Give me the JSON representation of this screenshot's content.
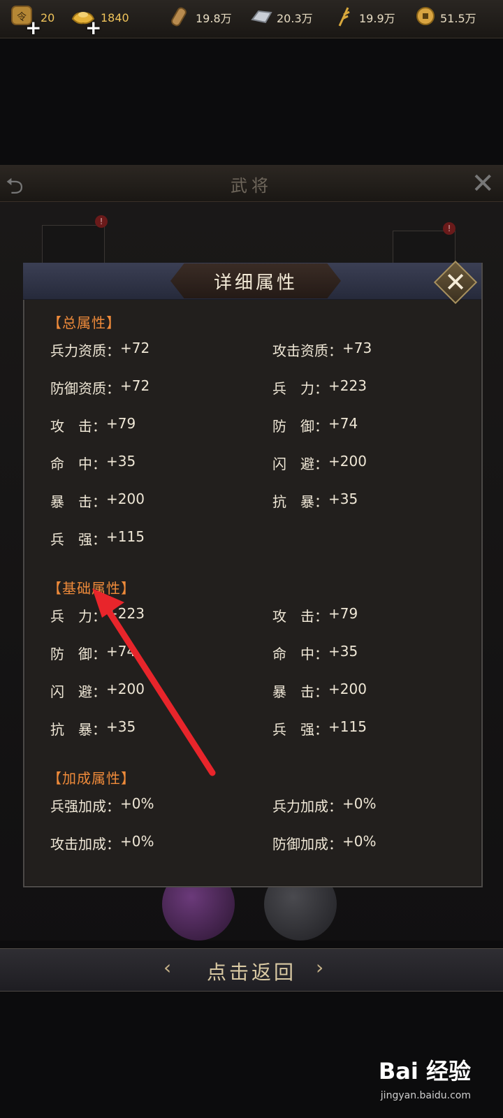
{
  "resources": {
    "tokens": "20",
    "gold": "1840",
    "wood": "19.8万",
    "iron": "20.3万",
    "grain": "19.9万",
    "coins": "51.5万"
  },
  "background": {
    "title": "武将"
  },
  "modal": {
    "title": "详细属性",
    "sections": [
      {
        "title": "【总属性】",
        "rows": [
          [
            {
              "label": "兵力资质：",
              "value": "+72"
            },
            {
              "label": "攻击资质：",
              "value": "+73"
            }
          ],
          [
            {
              "label": "防御资质：",
              "value": "+72"
            },
            {
              "label": "兵　力：",
              "value": "+223"
            }
          ],
          [
            {
              "label": "攻　击：",
              "value": "+79"
            },
            {
              "label": "防　御：",
              "value": "+74"
            }
          ],
          [
            {
              "label": "命　中：",
              "value": "+35"
            },
            {
              "label": "闪　避：",
              "value": "+200"
            }
          ],
          [
            {
              "label": "暴　击：",
              "value": "+200"
            },
            {
              "label": "抗　暴：",
              "value": "+35"
            }
          ],
          [
            {
              "label": "兵　强：",
              "value": "+115"
            },
            null
          ]
        ]
      },
      {
        "title": "【基础属性】",
        "rows": [
          [
            {
              "label": "兵　力：",
              "value": "+223"
            },
            {
              "label": "攻　击：",
              "value": "+79"
            }
          ],
          [
            {
              "label": "防　御：",
              "value": "+74"
            },
            {
              "label": "命　中：",
              "value": "+35"
            }
          ],
          [
            {
              "label": "闪　避：",
              "value": "+200"
            },
            {
              "label": "暴　击：",
              "value": "+200"
            }
          ],
          [
            {
              "label": "抗　暴：",
              "value": "+35"
            },
            {
              "label": "兵　强：",
              "value": "+115"
            }
          ]
        ]
      },
      {
        "title": "【加成属性】",
        "rows": [
          [
            {
              "label": "兵强加成：",
              "value": "+0%"
            },
            {
              "label": "兵力加成：",
              "value": "+0%"
            }
          ],
          [
            {
              "label": "攻击加成：",
              "value": "+0%"
            },
            {
              "label": "防御加成：",
              "value": "+0%"
            }
          ]
        ]
      }
    ]
  },
  "return_button": {
    "label": "点击返回"
  },
  "watermark": {
    "brand": "Bai 经验",
    "url": "jingyan.baidu.com"
  },
  "colors": {
    "section_title": "#ee8a3a",
    "annotation_arrow": "#e8252b"
  },
  "icons": [
    "token-icon",
    "gold-ingot-icon",
    "wood-icon",
    "iron-icon",
    "grain-icon",
    "coin-icon",
    "close-icon",
    "back-icon"
  ]
}
